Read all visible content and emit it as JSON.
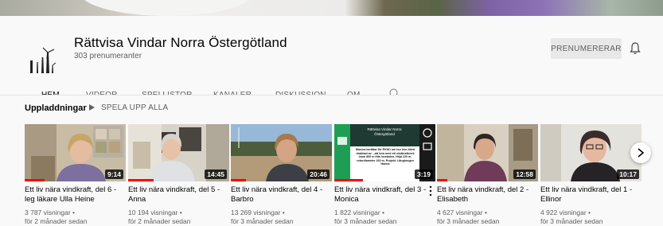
{
  "channel": {
    "name": "Rättvisa Vindar Norra Östergötland",
    "subscribers": "303 prenumeranter",
    "subscribe_label": "PRENUMERERAR"
  },
  "tabs": [
    {
      "label": "HEM",
      "active": true
    },
    {
      "label": "VIDEOR",
      "active": false
    },
    {
      "label": "SPELLISTOR",
      "active": false
    },
    {
      "label": "KANALER",
      "active": false
    },
    {
      "label": "DISKUSSION",
      "active": false
    },
    {
      "label": "OM",
      "active": false
    }
  ],
  "section": {
    "title": "Uppladdningar",
    "play_all": "SPELA UPP ALLA"
  },
  "thumb_texts": {
    "slide_header": "Rättvisa Vindar Norra Östergötland",
    "slide_body": "Monica berättar för RVNO om hur hon blivit drabbad av ...att leva med ett vindkraftverk inom 800 m från bostaden. Höjd 220 m, rotordiameter 160 m. Projekt: Långbrogen Hanna"
  },
  "videos": [
    {
      "title": "Ett liv nära vindkraft, del 6 - leg läkare Ulla Heine",
      "views": "3 787 visningar •",
      "ago": "för 2 månader sedan",
      "duration": "9:14",
      "progress": 0.2
    },
    {
      "title": "Ett liv nära vindkraft, del 5 - Anna",
      "views": "10 194 visningar •",
      "ago": "för 2 månader sedan",
      "duration": "14:45",
      "progress": 0.25
    },
    {
      "title": "Ett liv nära vindkraft, del 4 - Barbro",
      "views": "13 269 visningar •",
      "ago": "för 3 månader sedan",
      "duration": "20:46",
      "progress": 0.15
    },
    {
      "title": "Ett liv nära vindkraft, del 3 - Monica",
      "views": "1 822 visningar •",
      "ago": "för 3 månader sedan",
      "duration": "3:19",
      "progress": 0.28
    },
    {
      "title": "Ett liv nära vindkraft, del 2 - Elisabeth",
      "views": "4 627 visningar •",
      "ago": "för 3 månader sedan",
      "duration": "12:58",
      "progress": 0.1
    },
    {
      "title": "Ett liv nära vindkraft, del 1 - Ellinor",
      "views": "4 922 visningar •",
      "ago": "för 3 månader sedan",
      "duration": "10:17",
      "progress": 0.0
    }
  ],
  "colors": {
    "progress": "#ff0000",
    "slide_green": "#1e9e55",
    "slide_dark": "#1f3a33"
  }
}
